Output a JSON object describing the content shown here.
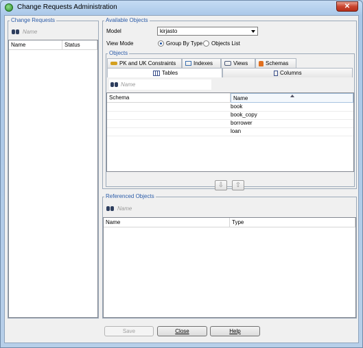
{
  "window": {
    "title": "Change Requests Administration",
    "close_glyph": "✕"
  },
  "change_requests": {
    "title": "Change Requests",
    "search_placeholder": "Name",
    "columns": [
      "Name",
      "Status"
    ]
  },
  "available_objects": {
    "title": "Available Objects",
    "model_label": "Model",
    "model_value": "kirjasto",
    "view_mode_label": "View Mode",
    "view_modes": [
      {
        "label": "Group By Type",
        "selected": true
      },
      {
        "label": "Objects List",
        "selected": false
      }
    ],
    "objects_title": "Objects",
    "tabs_row1": [
      {
        "label": "PK and UK Constraints",
        "icon": "key-icon"
      },
      {
        "label": "Indexes",
        "icon": "index-icon"
      },
      {
        "label": "Views",
        "icon": "view-icon"
      },
      {
        "label": "Schemas",
        "icon": "lock-icon"
      }
    ],
    "tabs_row2": [
      {
        "label": "Tables",
        "icon": "table-icon",
        "selected": true
      },
      {
        "label": "Columns",
        "icon": "column-icon",
        "selected": false
      }
    ],
    "search_placeholder": "Name",
    "columns": [
      "Schema",
      "Name"
    ],
    "rows": [
      {
        "schema": "",
        "name": "book"
      },
      {
        "schema": "",
        "name": "book_copy"
      },
      {
        "schema": "",
        "name": "borrower"
      },
      {
        "schema": "",
        "name": "loan"
      }
    ]
  },
  "move_buttons": {
    "down": "⇩",
    "up": "⇧"
  },
  "referenced_objects": {
    "title": "Referenced Objects",
    "search_placeholder": "Name",
    "columns": [
      "Name",
      "Type"
    ]
  },
  "footer": {
    "save": "Save",
    "close": "Close",
    "help": "Help"
  },
  "colors": {
    "group_title": "#2a5ba8",
    "close_button": "#c9452f"
  }
}
